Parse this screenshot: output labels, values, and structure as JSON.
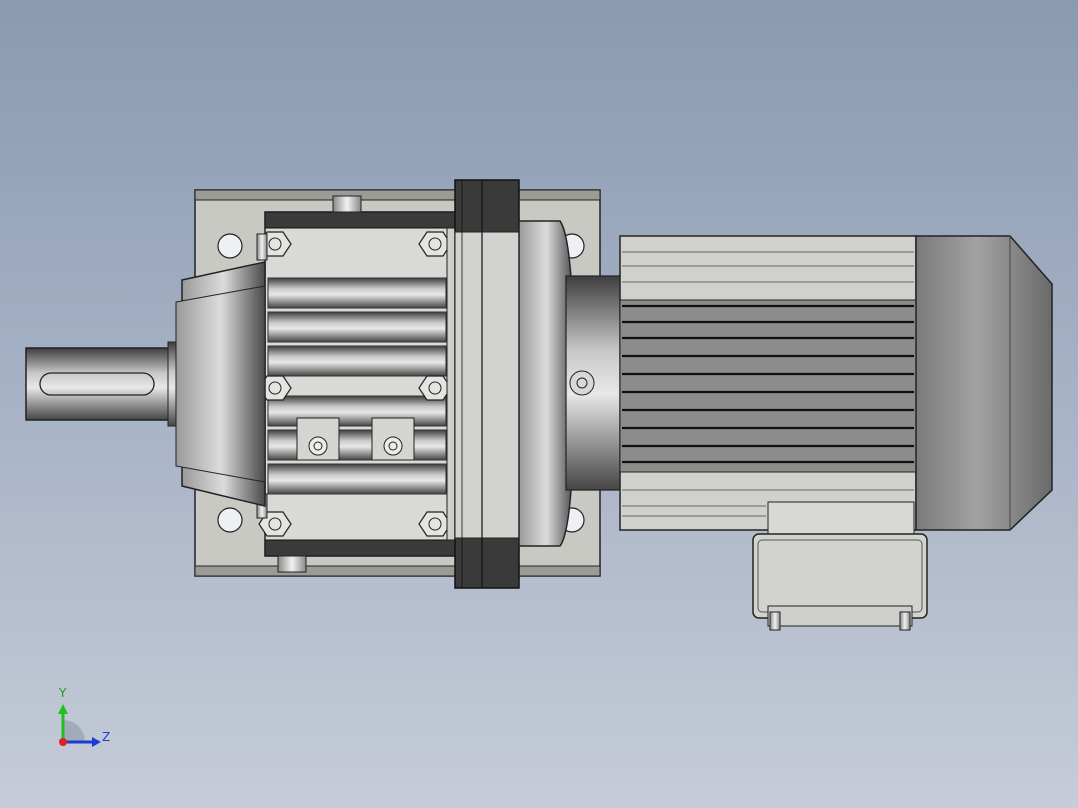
{
  "viewport": {
    "background_top": "#8a9ab0",
    "background_bottom": "#c6ccd8"
  },
  "model": {
    "description_icon": "gear-motor-icon"
  },
  "triad": {
    "y_label": "Y",
    "z_label": "Z",
    "colors": {
      "y": "#20c020",
      "z": "#1a3cd0",
      "x": "#e02020"
    }
  }
}
